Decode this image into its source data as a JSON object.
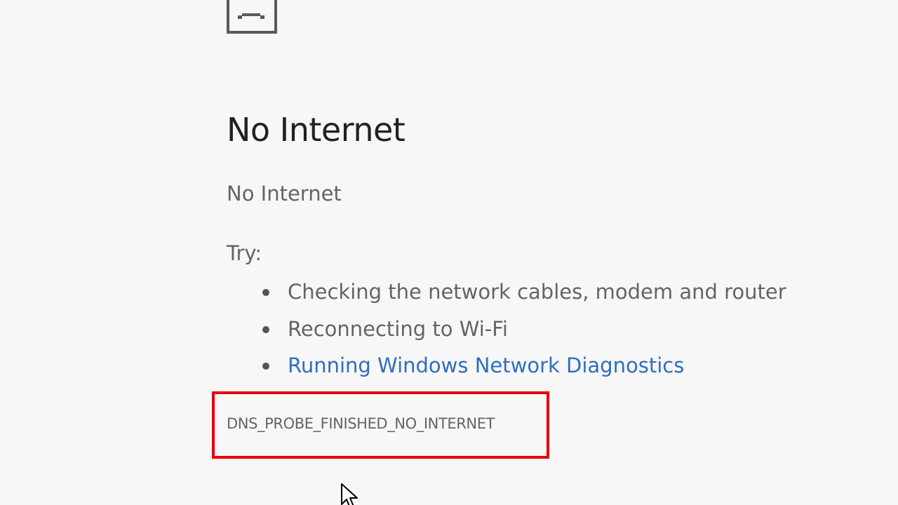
{
  "error_page": {
    "title": "No Internet",
    "subtitle": "No Internet",
    "try_label": "Try:",
    "suggestions": [
      {
        "text": "Checking the network cables, modem and router",
        "is_link": false
      },
      {
        "text": "Reconnecting to Wi-Fi",
        "is_link": false
      },
      {
        "text": "Running Windows Network Diagnostics",
        "is_link": true
      }
    ],
    "error_code": "DNS_PROBE_FINISHED_NO_INTERNET"
  },
  "icons": {
    "error": "sad-page-icon",
    "bullet": "bullet-dot-icon",
    "cursor": "mouse-pointer-icon"
  },
  "colors": {
    "background": "#f7f7f7",
    "heading": "#202124",
    "body_text": "#646464",
    "link": "#2f6ebf",
    "highlight": "#e8000a"
  }
}
